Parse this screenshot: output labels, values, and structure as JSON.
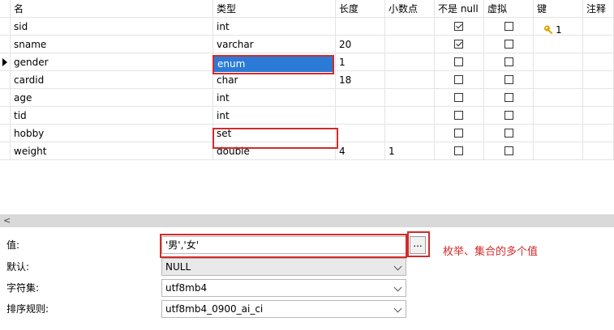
{
  "headers": {
    "name": "名",
    "type": "类型",
    "length": "长度",
    "decimals": "小数点",
    "not_null": "不是 null",
    "virtual": "虚拟",
    "key": "键",
    "comment": "注释"
  },
  "rows": [
    {
      "name": "sid",
      "type": "int",
      "length": "",
      "decimals": "",
      "not_null": true,
      "virtual": false,
      "key": "1"
    },
    {
      "name": "sname",
      "type": "varchar",
      "length": "20",
      "decimals": "",
      "not_null": true,
      "virtual": false,
      "key": ""
    },
    {
      "name": "gender",
      "type": "enum",
      "length": "1",
      "decimals": "",
      "not_null": false,
      "virtual": false,
      "key": ""
    },
    {
      "name": "cardid",
      "type": "char",
      "length": "18",
      "decimals": "",
      "not_null": false,
      "virtual": false,
      "key": ""
    },
    {
      "name": "age",
      "type": "int",
      "length": "",
      "decimals": "",
      "not_null": false,
      "virtual": false,
      "key": ""
    },
    {
      "name": "tid",
      "type": "int",
      "length": "",
      "decimals": "",
      "not_null": false,
      "virtual": false,
      "key": ""
    },
    {
      "name": "hobby",
      "type": "set",
      "length": "",
      "decimals": "",
      "not_null": false,
      "virtual": false,
      "key": ""
    },
    {
      "name": "weight",
      "type": "double",
      "length": "4",
      "decimals": "1",
      "not_null": false,
      "virtual": false,
      "key": ""
    }
  ],
  "scroll_left": "<",
  "props": {
    "value_label": "值:",
    "value": "'男','女'",
    "ellipsis": "...",
    "default_label": "默认:",
    "default": "NULL",
    "charset_label": "字符集:",
    "charset": "utf8mb4",
    "collation_label": "排序规则:",
    "collation": "utf8mb4_0900_ai_ci"
  },
  "annotation": "枚举、集合的多个值",
  "colors": {
    "accent": "#2b7ad6",
    "highlight": "#d42a2a"
  }
}
